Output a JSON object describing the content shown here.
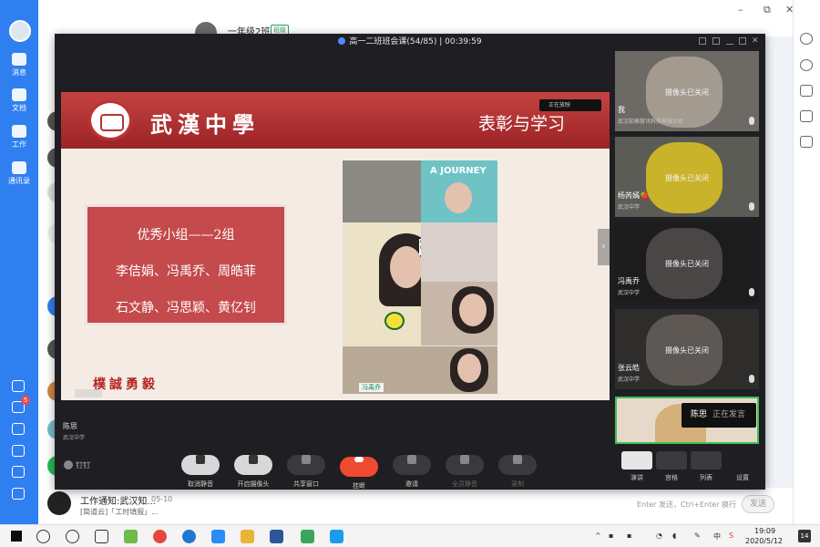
{
  "rail": {
    "items": [
      {
        "label": "消息",
        "icon": "chat-bubble-icon"
      },
      {
        "label": "文档",
        "icon": "document-icon"
      },
      {
        "label": "工作",
        "icon": "work-grid-icon"
      },
      {
        "label": "通讯录",
        "icon": "contacts-icon"
      }
    ],
    "todo_badge": "5"
  },
  "chat_header": {
    "group_name": "一年级2班",
    "group_tag": "班级",
    "window_controls": [
      "–",
      "⧉",
      "✕"
    ]
  },
  "notice": {
    "title": "工作通知:武汉知...",
    "date": "05-10",
    "subtitle": "[简道云]「工时填报」..."
  },
  "input": {
    "hint": "Enter 发送，Ctrl+Enter 换行",
    "send_label": "发送"
  },
  "meeting": {
    "title": "高一二班班会课(54/85) | 00:39:59",
    "slide": {
      "school_name": "武漢中學",
      "slide_title": "表彰与学习",
      "box_line1": "优秀小组——2组",
      "box_line2": "李佶娟、冯禹乔、周皓菲",
      "box_line3": "石文静、冯思颖、黄亿钊",
      "motto": "樸誠勇毅",
      "collage_title": "A JOURNEY",
      "collage_name_label": "冯禹乔",
      "mini_player": "正在放映"
    },
    "speaker_name": "陈思",
    "speaker_org": "武汉中学",
    "participants": [
      {
        "name": "我",
        "org": "武汉知格营讯科技有限公司",
        "status": "摄像头已关闭"
      },
      {
        "name": "杨芮嫣🍓",
        "org": "武汉中学",
        "status": "摄像头已关闭"
      },
      {
        "name": "冯禹乔",
        "org": "武汉中学",
        "status": "摄像头已关闭"
      },
      {
        "name": "张云皓",
        "org": "武汉中学",
        "status": "摄像头已关闭"
      }
    ],
    "speaking_name": "陈思",
    "speaking_status": "正在发言",
    "brand": "钉钉",
    "toolbar": [
      {
        "label": "取消静音",
        "icon": "mic-icon",
        "style": "light"
      },
      {
        "label": "开启摄像头",
        "icon": "camera-icon",
        "style": "light"
      },
      {
        "label": "共享窗口",
        "icon": "share-window-icon",
        "style": "dark"
      },
      {
        "label": "挂断",
        "icon": "hangup-icon",
        "style": "red"
      },
      {
        "label": "邀请",
        "icon": "invite-icon",
        "style": "dark"
      },
      {
        "label": "全员静音",
        "icon": "mute-all-icon",
        "style": "dark"
      },
      {
        "label": "录制",
        "icon": "record-icon",
        "style": "dark"
      }
    ],
    "views": [
      {
        "label": "演讲",
        "active": true
      },
      {
        "label": "宫格",
        "active": false
      },
      {
        "label": "列表",
        "active": false
      },
      {
        "label": "设置",
        "active": false
      }
    ]
  },
  "taskbar": {
    "time": "19:09",
    "date": "2020/5/12",
    "ime": "中",
    "notifications": "14"
  },
  "colors": {
    "rail_blue": "#2f7ff0",
    "hangup_red": "#ee4a2f",
    "slide_red": "#b33b3d",
    "active_speaker_green": "#3fbe58"
  }
}
